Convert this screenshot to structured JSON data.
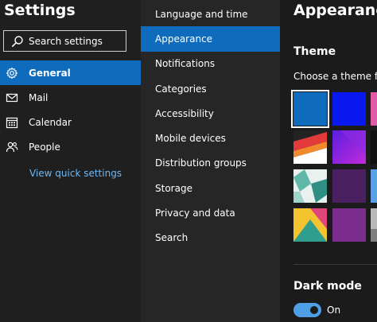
{
  "app": {
    "title": "Settings"
  },
  "search": {
    "placeholder": "Search settings"
  },
  "primary_nav": {
    "items": [
      {
        "label": "General",
        "icon": "gear-icon",
        "active": true
      },
      {
        "label": "Mail",
        "icon": "mail-icon",
        "active": false
      },
      {
        "label": "Calendar",
        "icon": "calendar-icon",
        "active": false
      },
      {
        "label": "People",
        "icon": "people-icon",
        "active": false
      }
    ],
    "quick_settings_link": "View quick settings"
  },
  "secondary_nav": {
    "items": [
      {
        "label": "Language and time",
        "active": false
      },
      {
        "label": "Appearance",
        "active": true
      },
      {
        "label": "Notifications",
        "active": false
      },
      {
        "label": "Categories",
        "active": false
      },
      {
        "label": "Accessibility",
        "active": false
      },
      {
        "label": "Mobile devices",
        "active": false
      },
      {
        "label": "Distribution groups",
        "active": false
      },
      {
        "label": "Storage",
        "active": false
      },
      {
        "label": "Privacy and data",
        "active": false
      },
      {
        "label": "Search",
        "active": false
      }
    ]
  },
  "appearance": {
    "title": "Appearance",
    "theme_heading": "Theme",
    "theme_prompt": "Choose a theme for",
    "themes": [
      {
        "name": "blue",
        "selected": true
      },
      {
        "name": "bright-blue",
        "selected": false
      },
      {
        "name": "colorful-stripes",
        "selected": false
      },
      {
        "name": "red-chevrons",
        "selected": false
      },
      {
        "name": "purple-gradient",
        "selected": false
      },
      {
        "name": "dark",
        "selected": false
      },
      {
        "name": "teal-geometric",
        "selected": false
      },
      {
        "name": "dark-purple",
        "selected": false
      },
      {
        "name": "sky",
        "selected": false
      },
      {
        "name": "yellow-geometric",
        "selected": false
      },
      {
        "name": "purple",
        "selected": false
      },
      {
        "name": "gray-landscape",
        "selected": false
      }
    ],
    "dark_mode_heading": "Dark mode",
    "dark_mode_state": "On"
  },
  "colors": {
    "accent": "#0f6cbd",
    "link": "#6cb8f6",
    "toggle_on": "#4f9fe6"
  }
}
